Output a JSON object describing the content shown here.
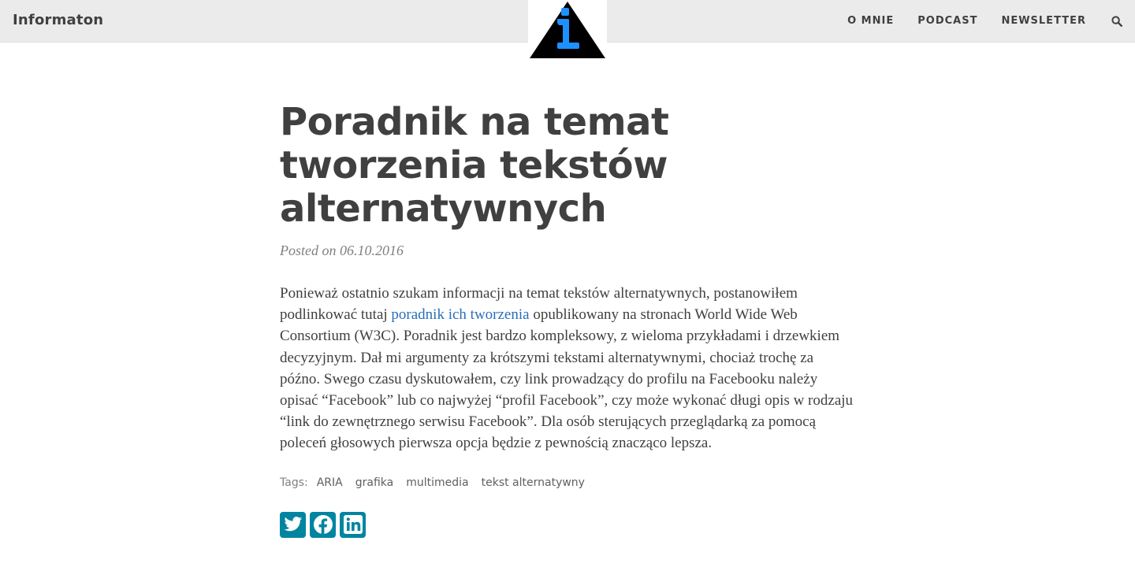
{
  "navbar": {
    "brand": "Informaton",
    "links": [
      "O MNIE",
      "PODCAST",
      "NEWSLETTER"
    ],
    "search_icon": "search-icon"
  },
  "logo": {
    "icon": "info-triangle-logo",
    "glyph": "i"
  },
  "post": {
    "title": "Poradnik na temat tworzenia tekstów alternatywnych",
    "meta": "Posted on 06.10.2016",
    "body_before_link": "Ponieważ ostatnio szukam informacji na temat tekstów alternatywnych, postanowiłem podlinkować tutaj ",
    "link_text": "poradnik ich tworzenia",
    "body_after_link": " opublikowany na stronach World Wide Web Consortium (W3C). Poradnik jest bardzo kompleksowy, z wieloma przykładami i drzewkiem decyzyjnym. Dał mi argumenty za krótszymi tekstami alternatywnymi, chociaż trochę za późno. Swego czasu dyskutowałem, czy link prowadzący do profilu na Facebooku należy opisać “Facebook” lub co najwyżej “profil Facebook”, czy może wykonać długi opis w rodzaju “link do zewnętrznego serwisu Facebook”. Dla osób sterujących przeglądarką za pomocą poleceń głosowych pierwsza opcja będzie z pewnością znacząco lepsza.",
    "tags_label": "Tags:",
    "tags": [
      "ARIA",
      "grafika",
      "multimedia",
      "tekst alternatywny"
    ]
  },
  "share": {
    "buttons": [
      "twitter-icon",
      "facebook-icon",
      "linkedin-icon"
    ],
    "color": "#0085a1"
  },
  "colors": {
    "navbar_bg": "#ebebeb",
    "text": "#404040",
    "link": "#2a6ebb",
    "logo_blue": "#1e90ff"
  }
}
